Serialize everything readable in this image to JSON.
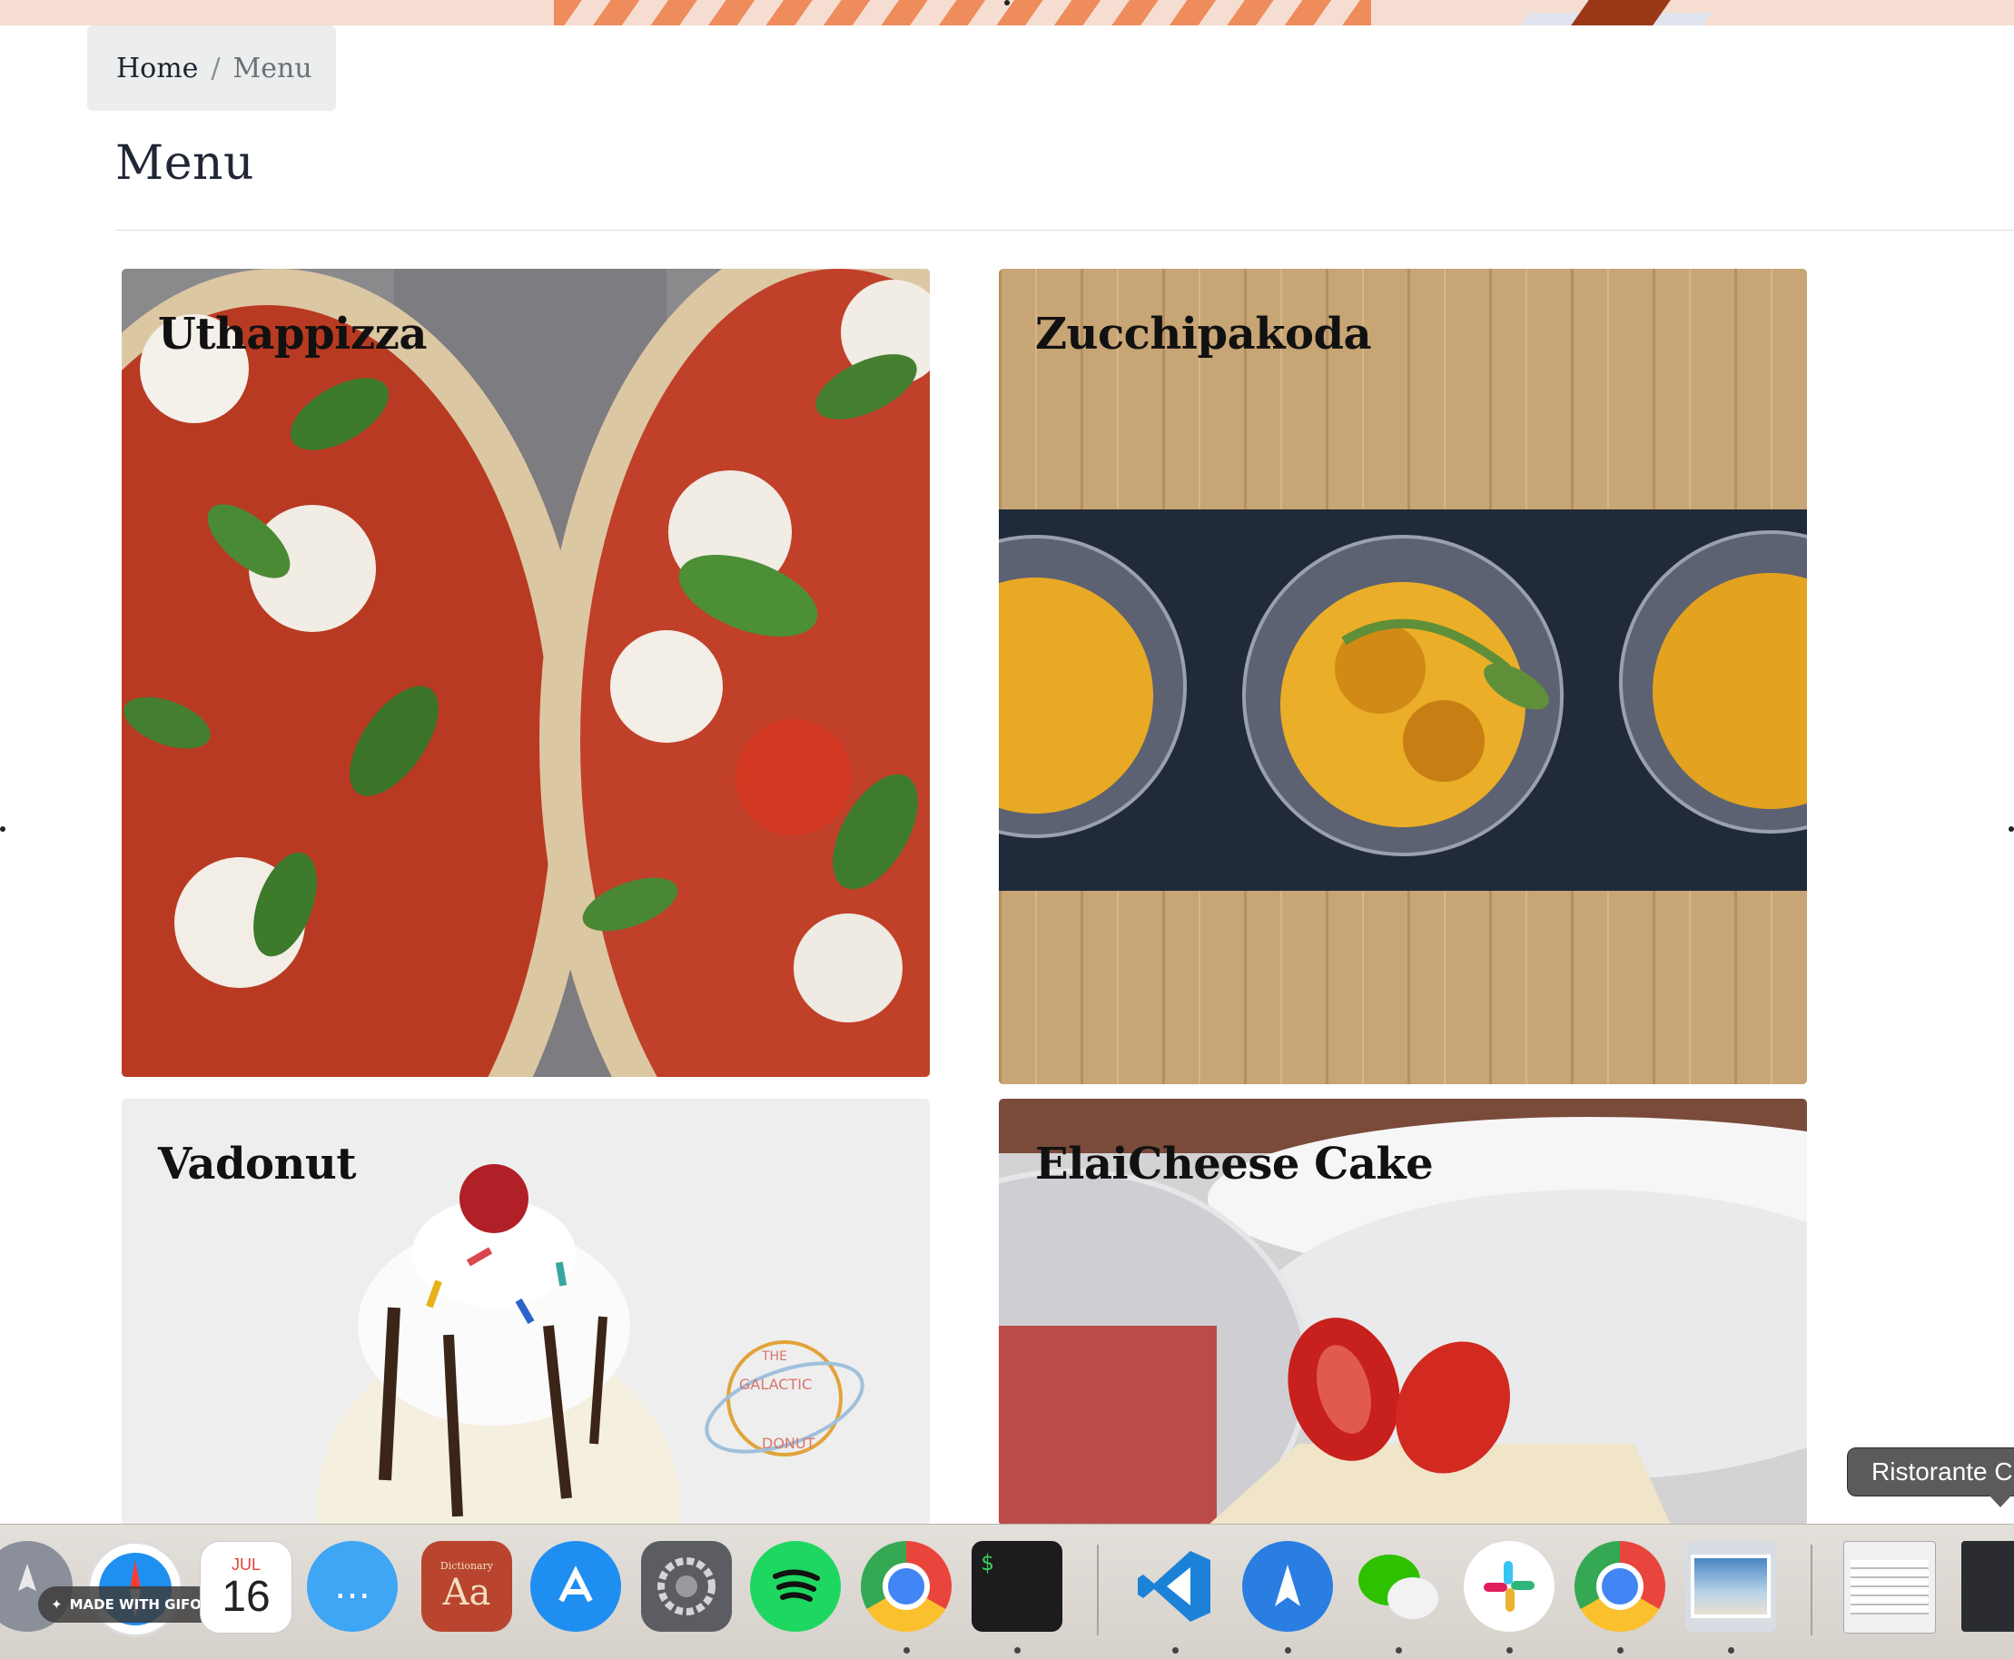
{
  "breadcrumb": {
    "home": "Home",
    "separator": "/",
    "current": "Menu"
  },
  "page": {
    "title": "Menu"
  },
  "menu": {
    "items": [
      {
        "name": "Uthappizza",
        "image": "pizza"
      },
      {
        "name": "Zucchipakoda",
        "image": "pakoda"
      },
      {
        "name": "Vadonut",
        "image": "ice-cream-donut"
      },
      {
        "name": "ElaiCheese Cake",
        "image": "cheesecake"
      }
    ],
    "logo_text": {
      "top": "THE",
      "left": "GALACTIC",
      "bottom": "DONUT"
    }
  },
  "dock": {
    "badge": "MADE WITH GIFOX",
    "calendar": {
      "month": "JUL",
      "day": "16"
    },
    "dictionary": {
      "label": "Dictionary",
      "glyph": "Aa"
    },
    "terminal_prompt": "$",
    "apps": [
      "launchpad-icon",
      "safari-icon",
      "calendar-icon",
      "messages-icon",
      "dictionary-icon",
      "app-store-icon",
      "system-preferences-icon",
      "spotify-icon",
      "chrome-icon",
      "terminal-icon",
      "vscode-icon",
      "spark-icon",
      "wechat-icon",
      "slack-icon",
      "chrome-icon",
      "preview-icon",
      "window-thumbnail",
      "window-thumbnail"
    ]
  },
  "tooltip": {
    "text": "Ristorante C"
  },
  "colors": {
    "breadcrumb_bg": "#eceded",
    "title": "#202635",
    "accent_stripe": "#ef8c5c"
  }
}
